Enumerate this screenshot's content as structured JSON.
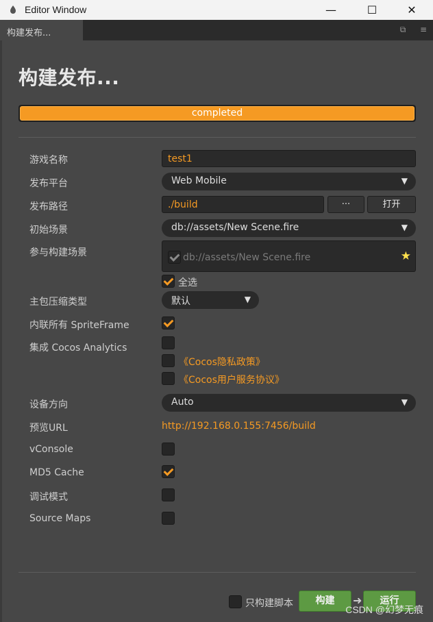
{
  "window": {
    "title": "Editor Window",
    "minimize": "—",
    "maximize": "☐",
    "close": "✕"
  },
  "tab": {
    "label": "构建发布...",
    "restore_icon": "⧉",
    "menu_icon": "≡"
  },
  "page": {
    "title": "构建发布..."
  },
  "progress": {
    "label": "completed",
    "fraction": 1.0
  },
  "form": {
    "game_name": {
      "label": "游戏名称",
      "value": "test1"
    },
    "platform": {
      "label": "发布平台",
      "value": "Web Mobile"
    },
    "build_path": {
      "label": "发布路径",
      "value": "./build",
      "browse": "···",
      "open": "打开"
    },
    "start_scene": {
      "label": "初始场景",
      "value": "db://assets/New Scene.fire"
    },
    "included_scenes": {
      "label": "参与构建场景",
      "scene": "db://assets/New Scene.fire",
      "select_all": "全选",
      "select_all_checked": true
    },
    "compression": {
      "label": "主包压缩类型",
      "value": "默认"
    },
    "inline_spriteframe": {
      "label": "内联所有 SpriteFrame",
      "checked": true
    },
    "analytics": {
      "label": "集成 Cocos Analytics",
      "checked": false,
      "privacy": "《Cocos隐私政策》",
      "privacy_checked": false,
      "terms": "《Cocos用户服务协议》",
      "terms_checked": false
    },
    "orientation": {
      "label": "设备方向",
      "value": "Auto"
    },
    "preview_url": {
      "label": "预览URL",
      "value": "http://192.168.0.155:7456/build"
    },
    "vconsole": {
      "label": "vConsole",
      "checked": false
    },
    "md5": {
      "label": "MD5 Cache",
      "checked": true
    },
    "debug": {
      "label": "调试模式",
      "checked": false
    },
    "source_maps": {
      "label": "Source Maps",
      "checked": false
    }
  },
  "footer": {
    "script_only": "只构建脚本",
    "script_only_checked": false,
    "build": "构建",
    "run": "运行"
  },
  "watermark": "CSDN @幻梦无痕",
  "colors": {
    "accent": "#f59a23",
    "button_green": "#5d9a43",
    "panel": "#474747"
  }
}
